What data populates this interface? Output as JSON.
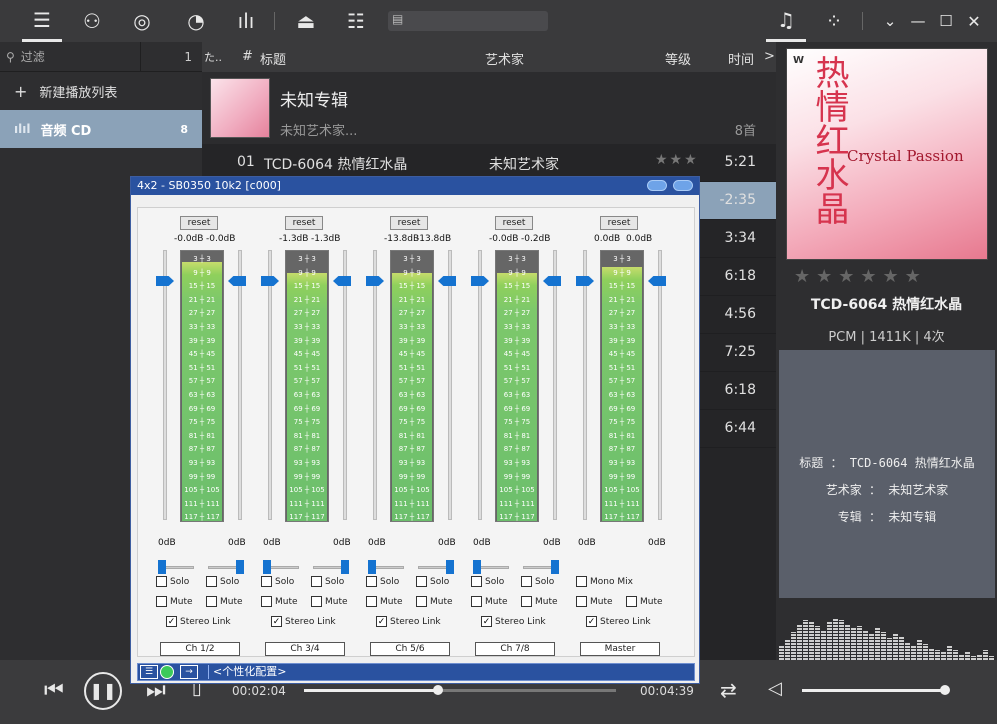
{
  "topbar": {
    "icons": [
      "list-icon",
      "user-icon",
      "disc-icon",
      "gauge-icon",
      "equalizer-icon",
      "eject-icon",
      "sliders-icon",
      "tab-icon",
      "music-note-icon",
      "grid-icon",
      "chevron-down-icon",
      "minimize-icon",
      "maximize-icon",
      "close-icon"
    ]
  },
  "left": {
    "filter_placeholder": "过滤",
    "filter_count": "1",
    "new_playlist": "新建播放列表",
    "cd_label": "音频 CD",
    "cd_count": "8"
  },
  "columns": {
    "c1": "た..",
    "c2": "#",
    "title": "标题",
    "artist": "艺术家",
    "rating": "等级",
    "time": "时间",
    "more": ">"
  },
  "album": {
    "title": "未知专辑",
    "artist": "未知艺术家...",
    "count": "8首"
  },
  "tracks": [
    {
      "num": "01",
      "title": "TCD-6064 热情红水晶",
      "artist": "未知艺术家",
      "stars": "★★★",
      "time": "5:21"
    },
    {
      "num": "",
      "title": "",
      "artist": "",
      "stars": "",
      "time": "-2:35"
    },
    {
      "num": "",
      "title": "",
      "artist": "",
      "stars": "",
      "time": "3:34"
    },
    {
      "num": "",
      "title": "",
      "artist": "",
      "stars": "",
      "time": "6:18"
    },
    {
      "num": "",
      "title": "",
      "artist": "",
      "stars": "",
      "time": "4:56"
    },
    {
      "num": "",
      "title": "",
      "artist": "",
      "stars": "",
      "time": "7:25"
    },
    {
      "num": "",
      "title": "",
      "artist": "",
      "stars": "",
      "time": "6:18"
    },
    {
      "num": "",
      "title": "",
      "artist": "",
      "stars": "",
      "time": "6:44"
    }
  ],
  "right": {
    "cover_big": "热情红水晶",
    "cover_en": "Crystal Passion",
    "cover_logo": "W",
    "rating": "★★★★★★",
    "title": "TCD-6064 热情红水晶",
    "format": "PCM  | 1411K | 4次",
    "info_title": "标题 ： TCD-6064 热情红水晶",
    "info_artist": "艺术家 ： 未知艺术家",
    "info_album": "专辑 ： 未知专辑"
  },
  "mixer": {
    "title": "4x2 - SB0350 10k2 [c000]",
    "reset": "reset",
    "zero_db": "0dB",
    "scale": [
      "3",
      "9",
      "15",
      "21",
      "27",
      "33",
      "39",
      "45",
      "51",
      "57",
      "63",
      "69",
      "75",
      "81",
      "87",
      "93",
      "99",
      "105",
      "111",
      "117"
    ],
    "solo": "Solo",
    "mute": "Mute",
    "mono_mix": "Mono Mix",
    "stereo_link": "Stereo Link",
    "config": "<个性化配置>",
    "channels": [
      {
        "name": "Ch 1/2",
        "db_l": "-0.0dB",
        "db_r": "-0.0dB",
        "level": 0.96
      },
      {
        "name": "Ch 3/4",
        "db_l": "-1.3dB",
        "db_r": "-1.3dB",
        "level": 0.92
      },
      {
        "name": "Ch 5/6",
        "db_l": "-13.8dB",
        "db_r": "-13.8dB",
        "level": 0.92
      },
      {
        "name": "Ch 7/8",
        "db_l": "-0.0dB",
        "db_r": "-0.2dB",
        "level": 0.92
      },
      {
        "name": "Master",
        "db_l": "0.0dB",
        "db_r": "0.0dB",
        "level": 0.94
      }
    ]
  },
  "playback": {
    "elapsed": "00:02:04",
    "total": "00:04:39",
    "progress": 0.43,
    "volume": 0.98
  }
}
